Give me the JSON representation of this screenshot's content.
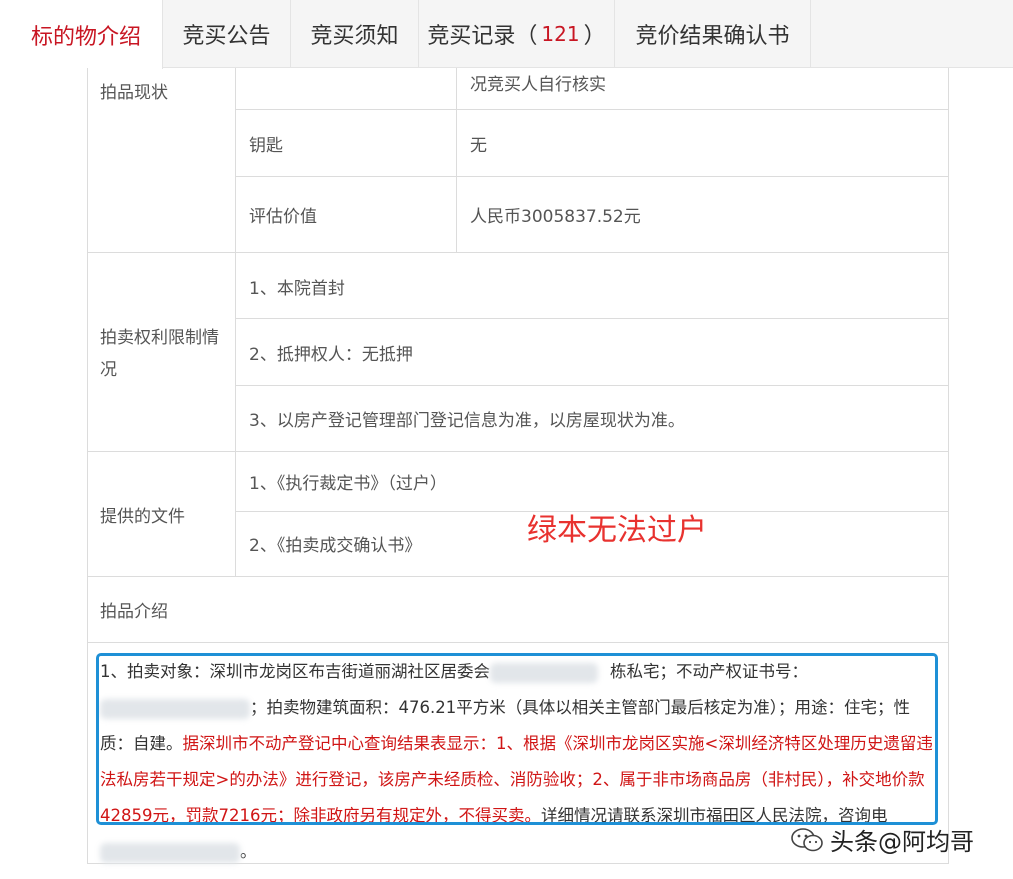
{
  "tabs": [
    {
      "label": "标的物介绍",
      "active": true
    },
    {
      "label": "竞买公告"
    },
    {
      "label": "竞买须知"
    },
    {
      "label": "竞买记录（",
      "count": "121",
      "suffix": "）"
    },
    {
      "label": "竞价结果确认书"
    }
  ],
  "table": {
    "item_status": {
      "label": "拍品现状",
      "top_value": "况竞买人自行核实",
      "key_label": "钥匙",
      "key_value": "无",
      "appraisal_label": "评估价值",
      "appraisal_value": "人民币3005837.52元"
    },
    "rights": {
      "label": "拍卖权利限制情况",
      "items": [
        "1、本院首封",
        "2、抵押权人：无抵押",
        "3、以房产登记管理部门登记信息为准，以房屋现状为准。"
      ]
    },
    "docs": {
      "label": "提供的文件",
      "items": [
        "1、《执行裁定书》（过户）",
        "2、《拍卖成交确认书》"
      ]
    }
  },
  "annotation": "绿本无法过户",
  "intro": {
    "title": "拍品介绍",
    "p1a": "1、拍卖对象：深圳市龙岗区布吉街道丽湖社区居委会",
    "p1b": "栋私宅；不动产权证书号：",
    "p1c": "；拍卖物建筑面积：476.21平方米（具体以相关主管部门最后核定为准）；用途：住宅；性质：自建。",
    "red": "据深圳市不动产登记中心查询结果表显示：1、根据《深圳市龙岗区实施<深圳经济特区处理历史遗留违法私房若干规定>的办法》进行登记，该房产未经质检、消防验收；2、属于非市场商品房（非村民），补交地价款42859元，罚款7216元；除非政府另有规定外，不得买卖。",
    "p2": "详细情况请联系深圳市福田区人民法院，咨询电",
    "p2end": "。"
  },
  "watermark": "头条@阿均哥"
}
